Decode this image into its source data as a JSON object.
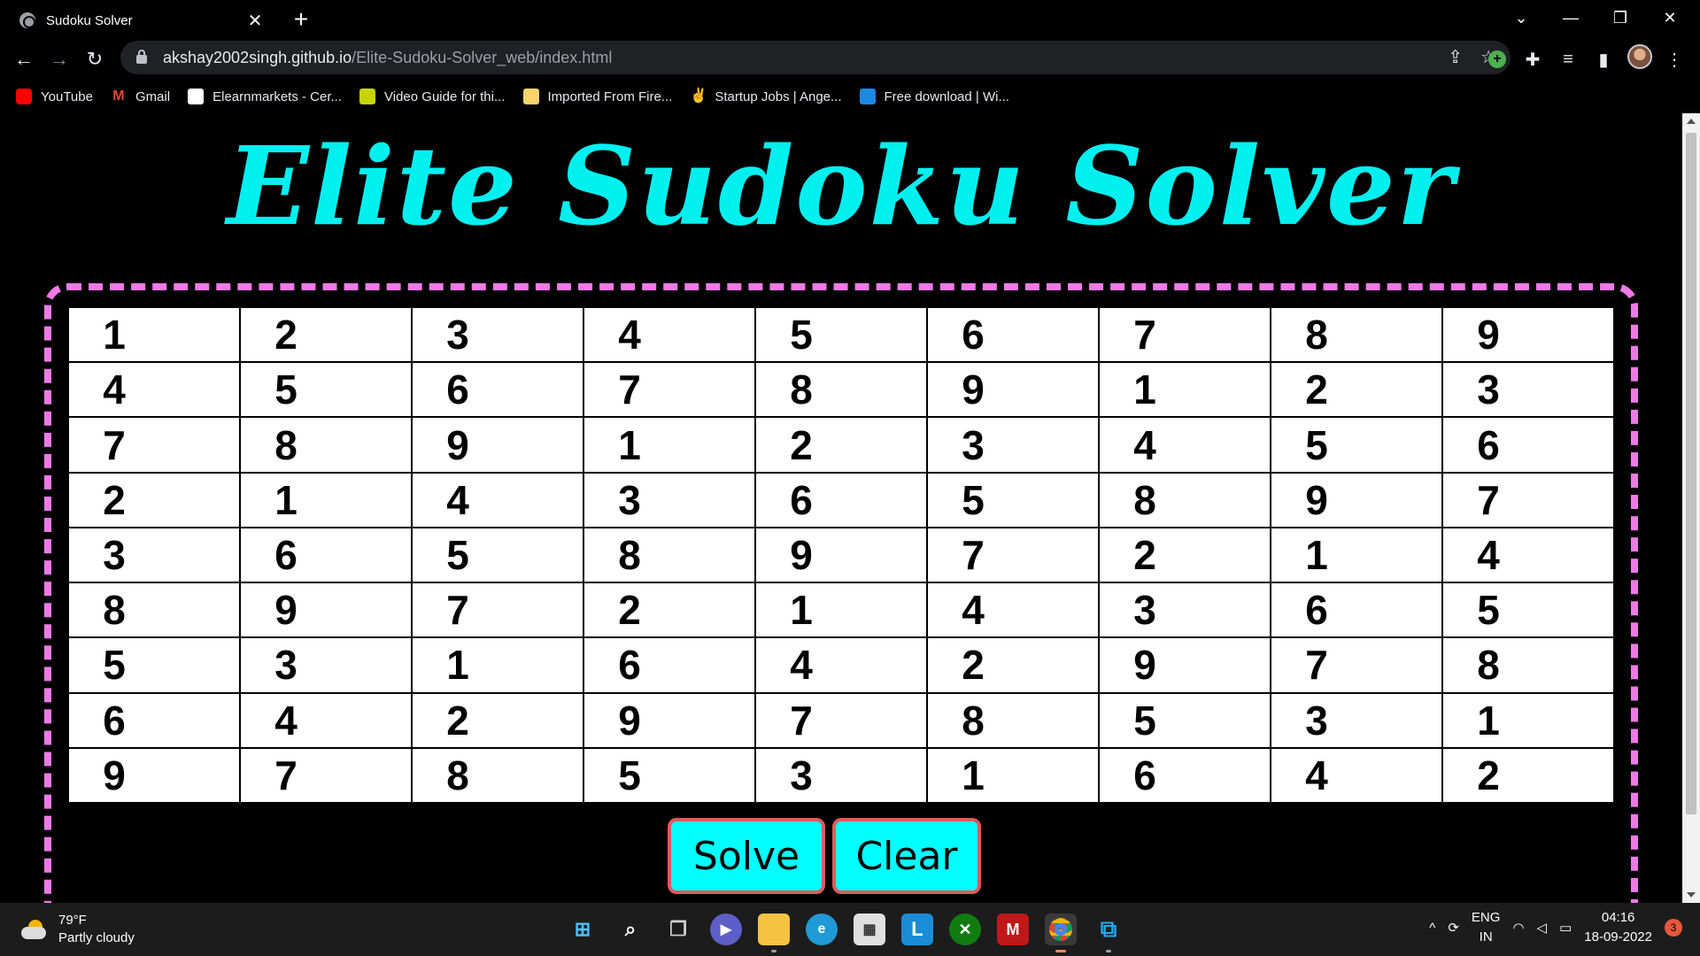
{
  "browser": {
    "tab_title": "Sudoku Solver",
    "tab_close": "✕",
    "new_tab": "+",
    "url_host": "akshay2002singh.github.io",
    "url_path": "/Elite-Sudoku-Solver_web/index.html",
    "bookmarks": [
      {
        "label": "YouTube",
        "icon": "youtube-icon",
        "color": "#ff0000"
      },
      {
        "label": "Gmail",
        "icon": "gmail-icon",
        "color": "#ea4335"
      },
      {
        "label": "Elearnmarkets - Cer...",
        "icon": "elearnmarkets-icon",
        "color": "#ffffff"
      },
      {
        "label": "Video Guide for thi...",
        "icon": "video-guide-icon",
        "color": "#c8d400"
      },
      {
        "label": "Imported From Fire...",
        "icon": "folder-icon",
        "color": "#f6d36b"
      },
      {
        "label": "Startup Jobs | Ange...",
        "icon": "angellist-icon",
        "color": "#ffffff"
      },
      {
        "label": "Free download | Wi...",
        "icon": "free-download-icon",
        "color": "#1e88e5"
      }
    ]
  },
  "page": {
    "title": "Elite Sudoku Solver",
    "grid": [
      [
        "1",
        "2",
        "3",
        "4",
        "5",
        "6",
        "7",
        "8",
        "9"
      ],
      [
        "4",
        "5",
        "6",
        "7",
        "8",
        "9",
        "1",
        "2",
        "3"
      ],
      [
        "7",
        "8",
        "9",
        "1",
        "2",
        "3",
        "4",
        "5",
        "6"
      ],
      [
        "2",
        "1",
        "4",
        "3",
        "6",
        "5",
        "8",
        "9",
        "7"
      ],
      [
        "3",
        "6",
        "5",
        "8",
        "9",
        "7",
        "2",
        "1",
        "4"
      ],
      [
        "8",
        "9",
        "7",
        "2",
        "1",
        "4",
        "3",
        "6",
        "5"
      ],
      [
        "5",
        "3",
        "1",
        "6",
        "4",
        "2",
        "9",
        "7",
        "8"
      ],
      [
        "6",
        "4",
        "2",
        "9",
        "7",
        "8",
        "5",
        "3",
        "1"
      ],
      [
        "9",
        "7",
        "8",
        "5",
        "3",
        "1",
        "6",
        "4",
        "2"
      ]
    ],
    "solve_label": "Solve",
    "clear_label": "Clear",
    "colors": {
      "title": "#00f0f0",
      "frame": "#ee7ae6",
      "button": "#00ffff",
      "button_border": "#e05a5a"
    }
  },
  "taskbar": {
    "temperature": "79°F",
    "condition": "Partly cloudy",
    "lang_1": "ENG",
    "lang_2": "IN",
    "time": "04:16",
    "date": "18-09-2022",
    "notifications": "3"
  }
}
